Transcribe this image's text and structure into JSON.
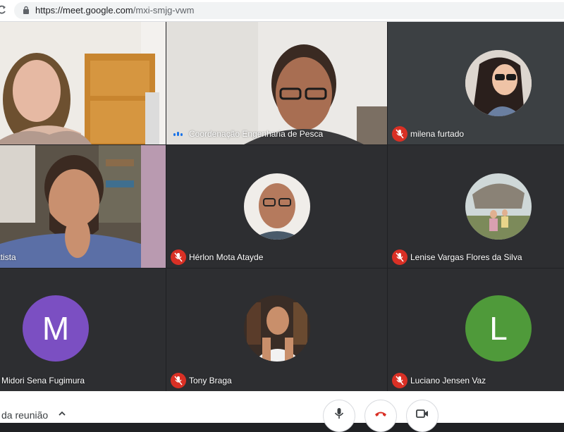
{
  "browser": {
    "url_domain": "https://meet.google.com",
    "url_path": "/mxi-smjg-vwm"
  },
  "participants": [
    {
      "name": "",
      "mic": "video"
    },
    {
      "name": "Coordenação Engenharia de Pesca",
      "mic": "speaking"
    },
    {
      "name": "milena furtado",
      "mic": "muted"
    },
    {
      "name": "atista",
      "mic": "video"
    },
    {
      "name": "Hérlon Mota Atayde",
      "mic": "muted"
    },
    {
      "name": "Lenise Vargas Flores da Silva",
      "mic": "muted"
    },
    {
      "name": "Midori Sena Fugimura",
      "mic": "hidden",
      "initial": "M",
      "avatar_color": "#7b4fc2"
    },
    {
      "name": "Tony Braga",
      "mic": "muted"
    },
    {
      "name": "Luciano Jensen Vaz",
      "mic": "muted",
      "initial": "L",
      "avatar_color": "#4f9a3a"
    }
  ],
  "controls": {
    "meeting_details_label": "da reunião",
    "mic_icon": "microphone-icon",
    "hangup_icon": "hang-up-icon",
    "camera_icon": "camera-icon"
  },
  "colors": {
    "accent": "#1a73e8",
    "danger": "#d93025",
    "tile_bg": "#3c4043"
  }
}
